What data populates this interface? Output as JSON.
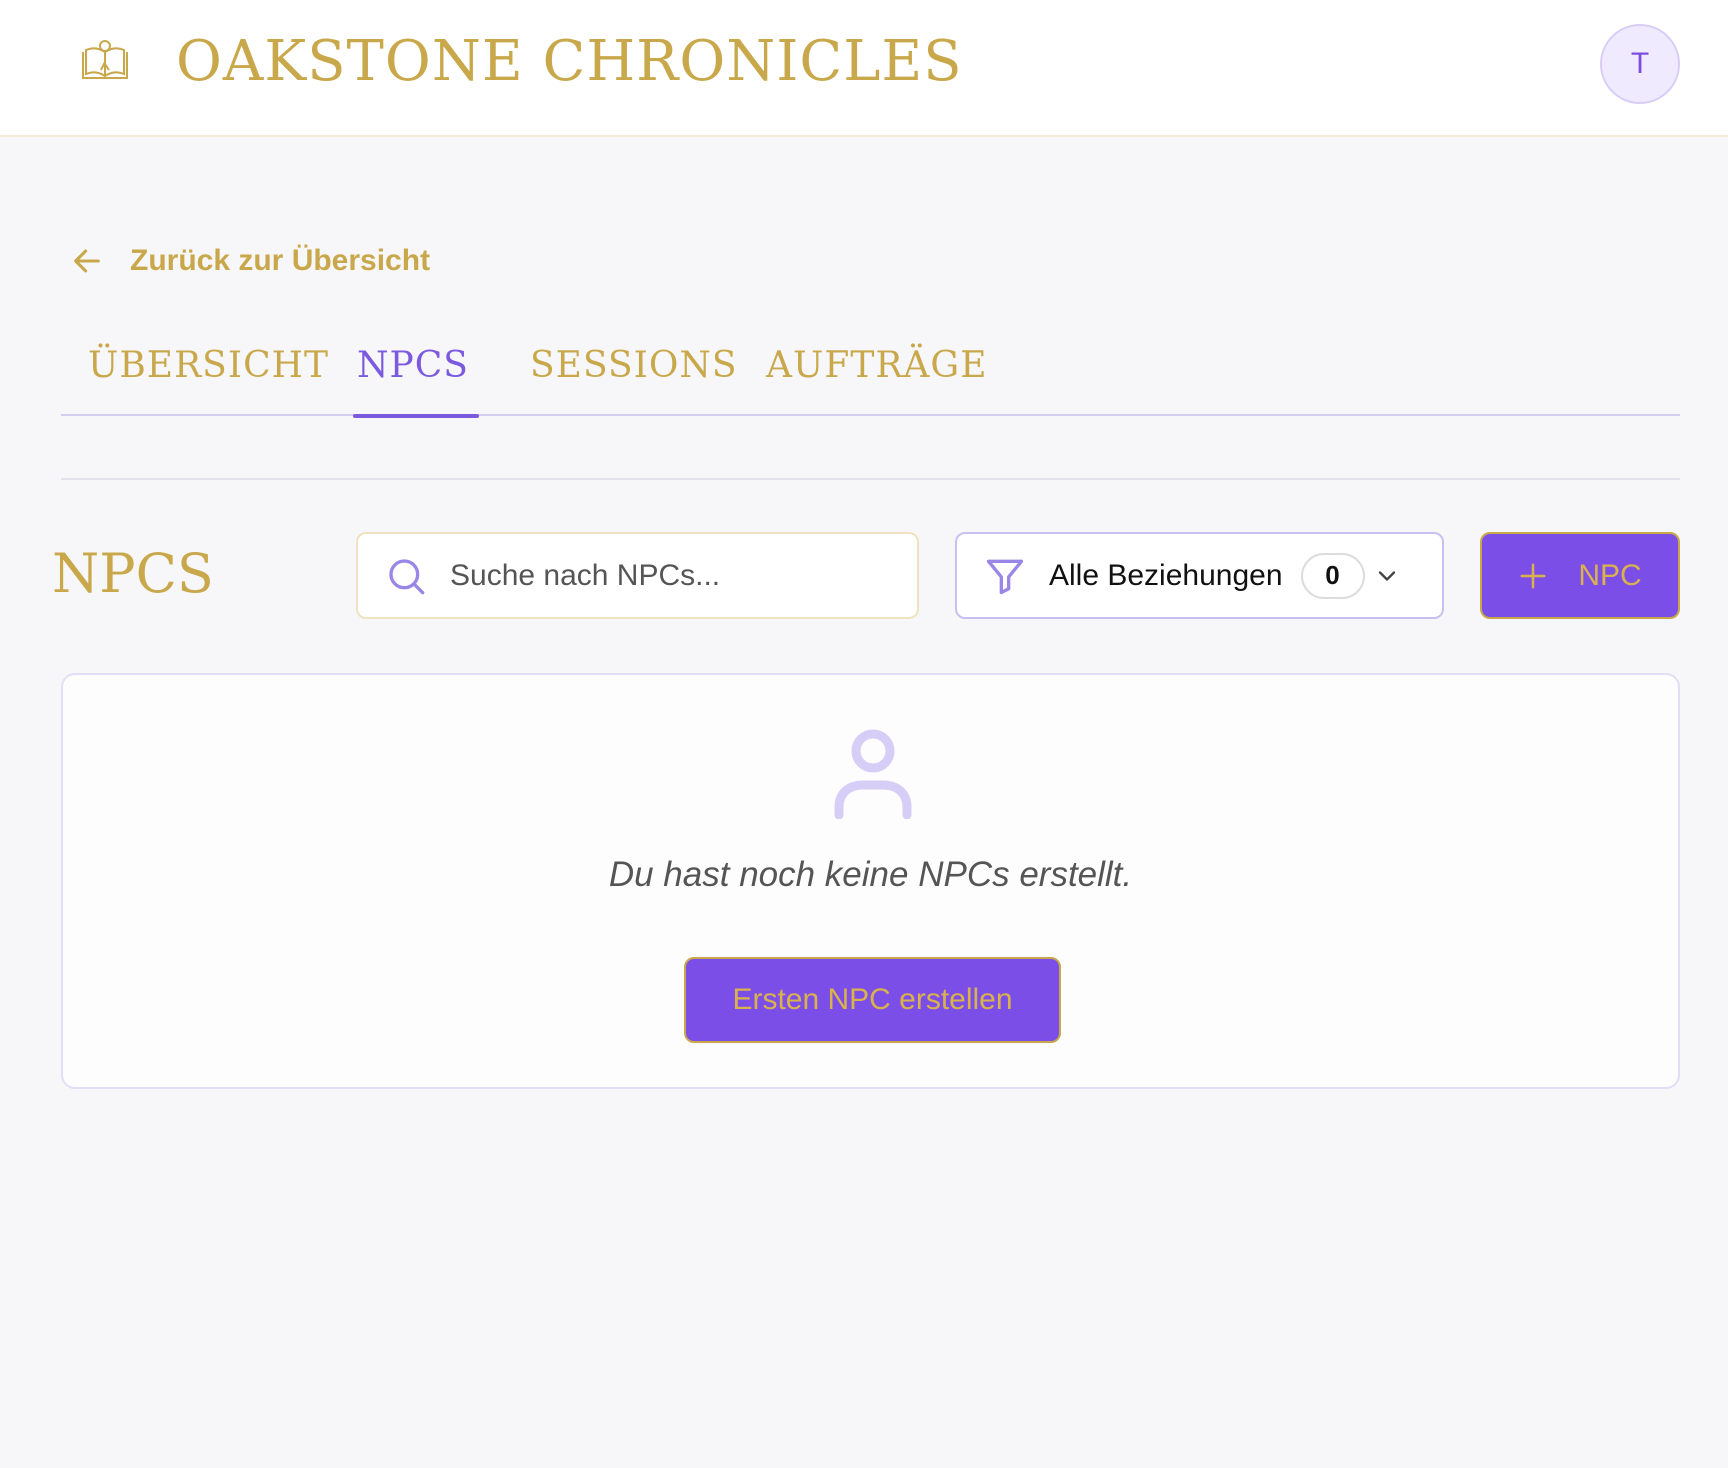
{
  "app": {
    "title": "OAKSTONE CHRONICLES",
    "logo_icon": "open-book-rose-icon",
    "user_initial": "T"
  },
  "nav": {
    "back_label": "Zurück zur Übersicht",
    "tabs": [
      {
        "label": "ÜBERSICHT",
        "active": false
      },
      {
        "label": "NPCS",
        "active": true
      },
      {
        "label": "SESSIONS",
        "active": false
      },
      {
        "label": "AUFTRÄGE",
        "active": false
      }
    ]
  },
  "npcs": {
    "section_title": "NPCS",
    "search_placeholder": "Suche nach NPCs...",
    "filter_label": "Alle Beziehungen",
    "filter_count": "0",
    "add_button_label": "NPC",
    "empty_message": "Du hast noch keine NPCs erstellt.",
    "create_first_label": "Ersten NPC erstellen"
  },
  "colors": {
    "gold": "#c9a84c",
    "purple": "#7c4ee8",
    "purple_text": "#7c5ae0",
    "background": "#f7f7f9"
  }
}
